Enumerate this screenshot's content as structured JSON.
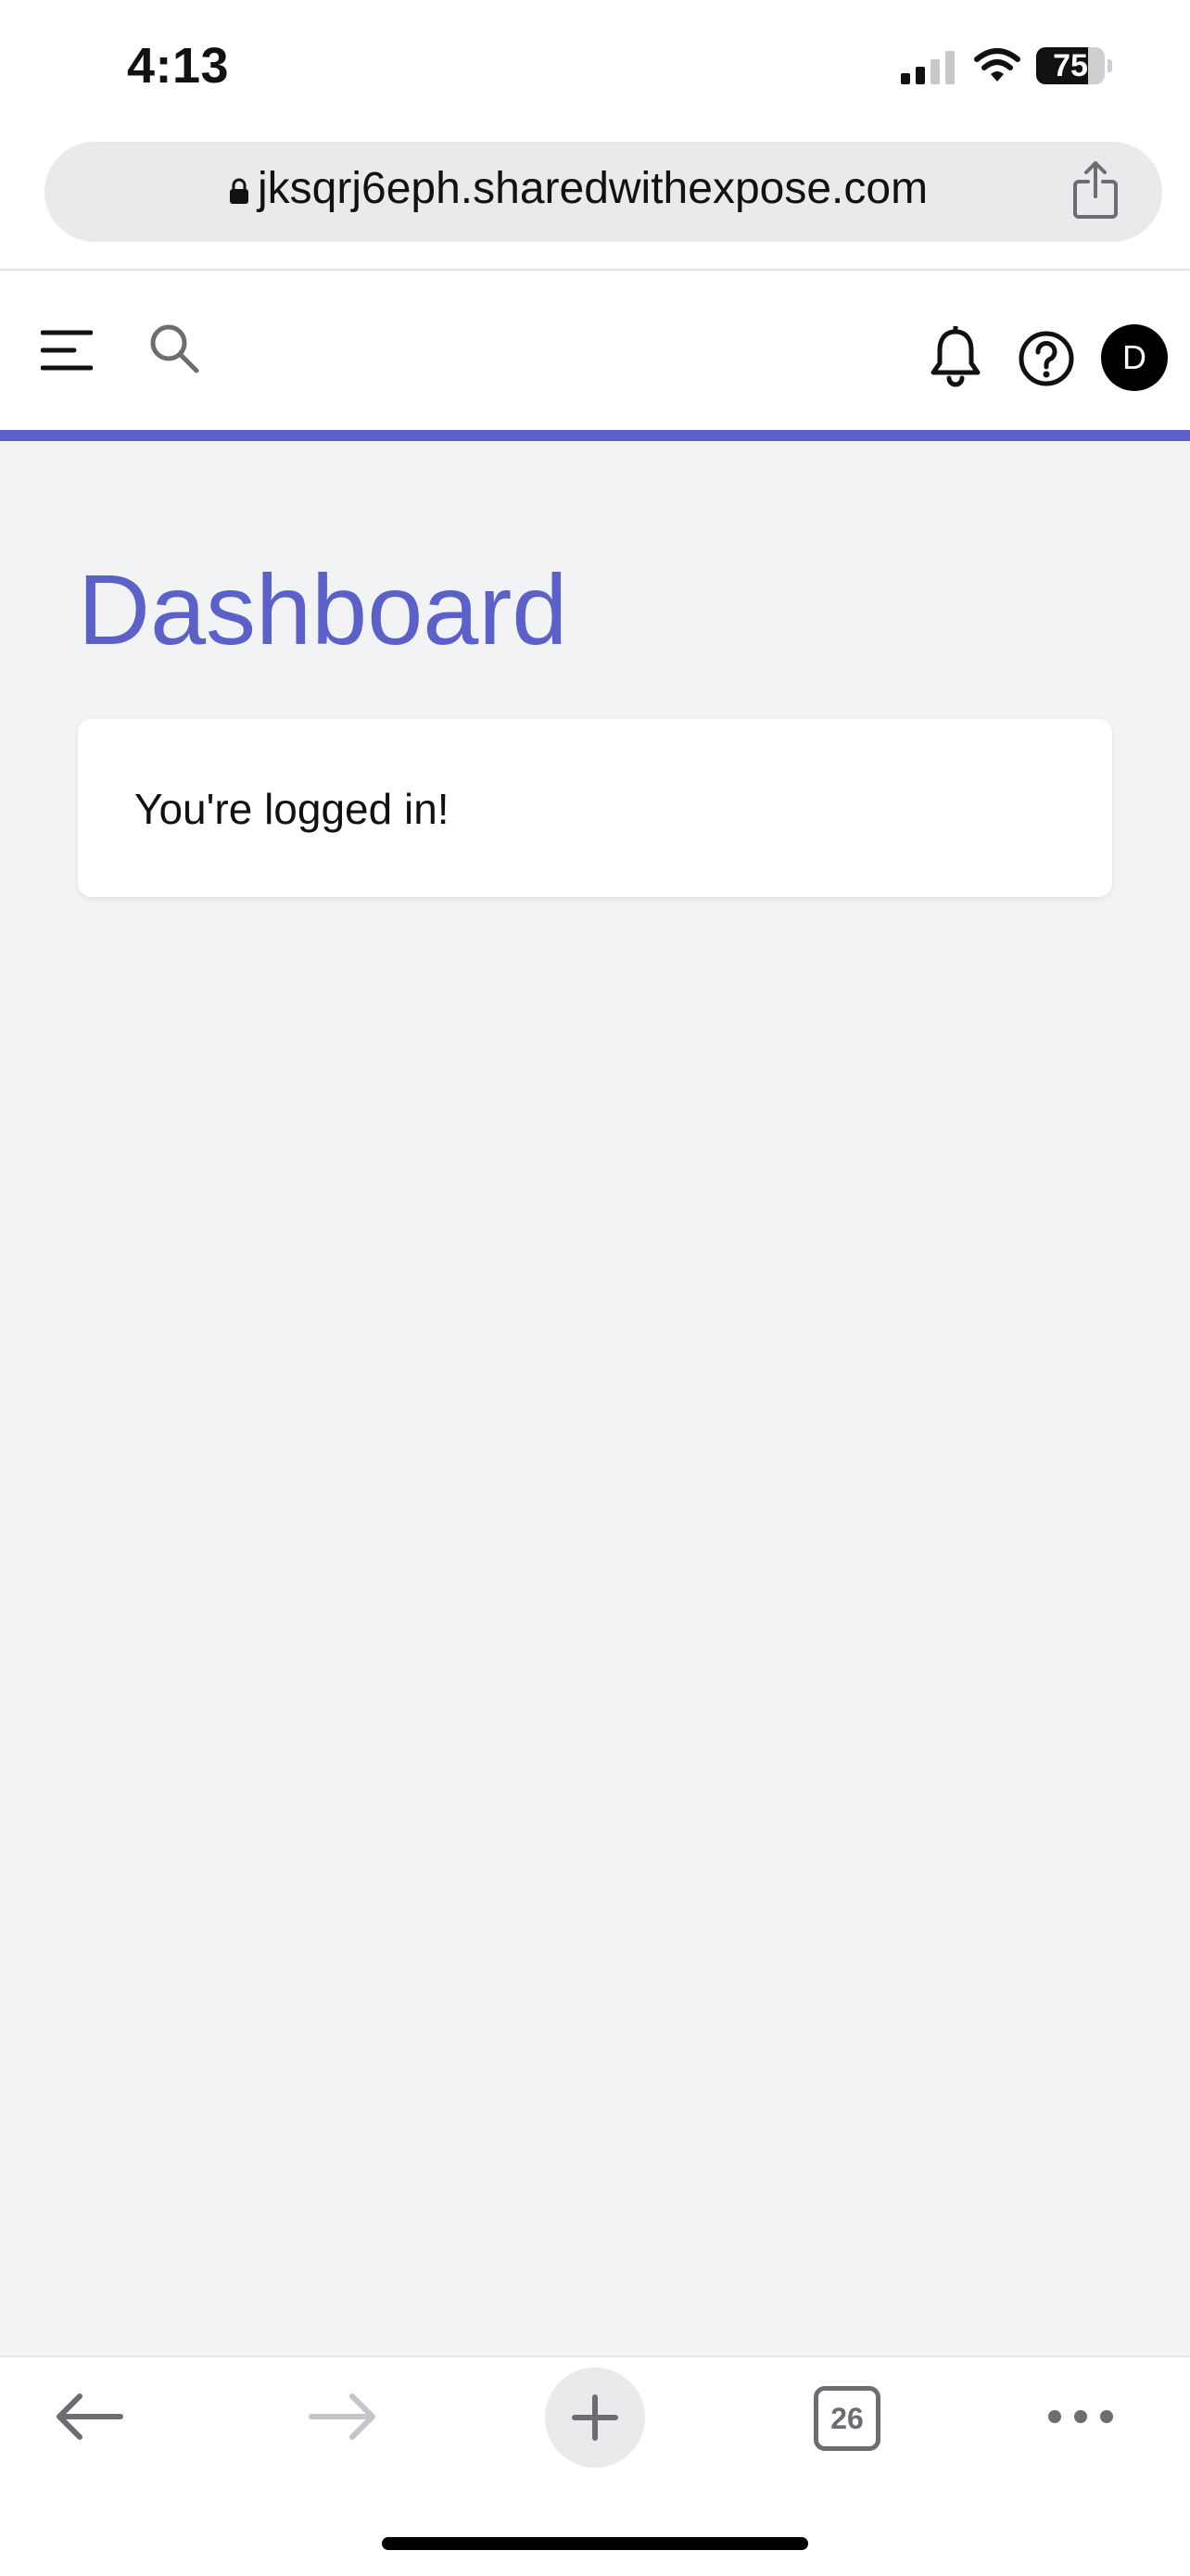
{
  "status_bar": {
    "time": "4:13",
    "battery_percent": "75",
    "battery_level": 0.75
  },
  "browser": {
    "url": "jksqrj6eph.sharedwithexpose.com",
    "tab_count": "26",
    "icons": {
      "lock": "lock-icon",
      "share": "share-icon",
      "back": "arrow-left-icon",
      "forward": "arrow-right-icon",
      "new_tab": "plus-icon",
      "tabs": "tabs-icon",
      "more": "more-icon"
    }
  },
  "app_header": {
    "avatar_initial": "D",
    "icons": {
      "menu": "menu-icon",
      "search": "search-icon",
      "notifications": "bell-icon",
      "help": "help-icon"
    }
  },
  "main": {
    "title": "Dashboard",
    "message": "You're logged in!"
  },
  "colors": {
    "accent": "#5b61c9",
    "page_background": "#f2f3f5",
    "surface": "#ffffff",
    "urlbar_background": "#e9eaec",
    "toolbar_icon": "#6b6d72"
  }
}
